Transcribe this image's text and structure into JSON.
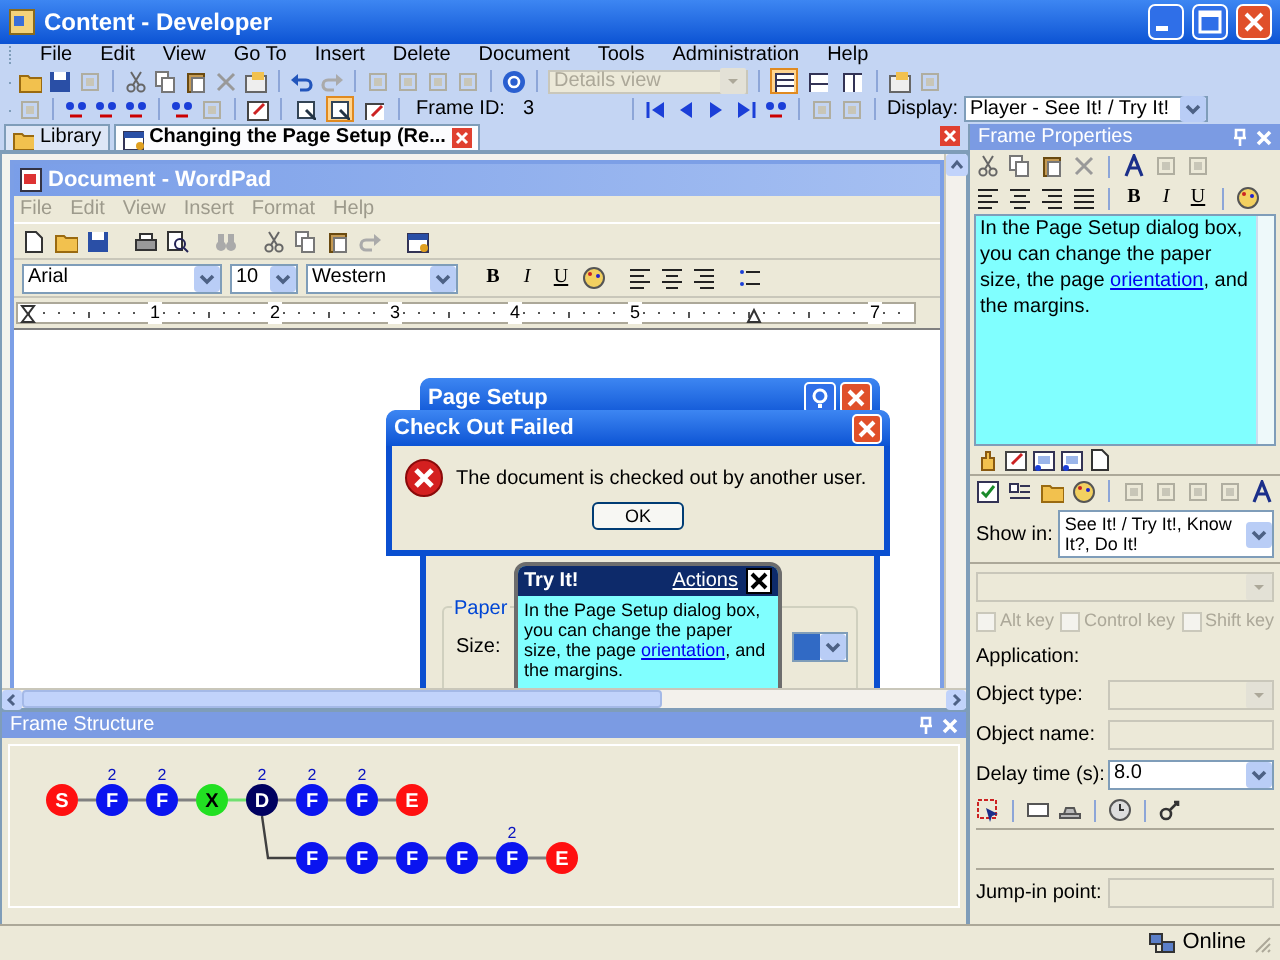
{
  "window": {
    "title": "Content - Developer"
  },
  "menu": [
    "File",
    "Edit",
    "View",
    "Go To",
    "Insert",
    "Delete",
    "Document",
    "Tools",
    "Administration",
    "Help"
  ],
  "toolbar": {
    "view_dropdown": {
      "value": "Details view",
      "disabled": true
    },
    "view_layouts": [
      {
        "selected": true
      },
      {
        "selected": false
      },
      {
        "selected": false
      }
    ],
    "frame_tools": [
      {
        "selected": false
      },
      {
        "selected": true
      },
      {
        "selected": false
      }
    ],
    "frame_id_label": "Frame ID:",
    "frame_id": "3",
    "display_label": "Display:",
    "display": "Player - See It! / Try It!"
  },
  "tabs": [
    {
      "label": "Library",
      "selected": false
    },
    {
      "label": "Changing the Page Setup (Re...",
      "selected": true
    }
  ],
  "wordpad": {
    "title": "Document - WordPad",
    "menu": [
      "File",
      "Edit",
      "View",
      "Insert",
      "Format",
      "Help"
    ],
    "font": "Arial",
    "size": "10",
    "script": "Western",
    "format_buttons": [
      "B",
      "I",
      "U"
    ],
    "ruler": [
      "1",
      "2",
      "3",
      "4",
      "5",
      "7"
    ]
  },
  "page_setup": {
    "title": "Page Setup",
    "group": "Paper",
    "size_label": "Size:"
  },
  "error_dialog": {
    "title": "Check Out Failed",
    "message": "The document is checked out by another user.",
    "button": "OK"
  },
  "bubble": {
    "title": "Try It!",
    "link": "Actions",
    "text": {
      "before": "In the Page Setup dialog box, you can change the paper size, the page ",
      "link": "orientation",
      "after": ", and the margins."
    }
  },
  "frame_properties": {
    "title": "Frame Properties",
    "format_buttons": [
      "B",
      "I",
      "U"
    ],
    "text": {
      "before": "In the Page Setup dialog box, you can change the paper size, the page ",
      "link": "orientation",
      "after": ", and the margins."
    },
    "show_in_label": "Show in:",
    "show_in": "See It! / Try It!, Know It?, Do It!",
    "checkboxes": [
      {
        "label": "Alt key",
        "checked": false,
        "disabled": true
      },
      {
        "label": "Control key",
        "checked": false,
        "disabled": true
      },
      {
        "label": "Shift key",
        "checked": false,
        "disabled": true
      }
    ],
    "application_label": "Application:",
    "object_type_label": "Object type:",
    "object_name_label": "Object name:",
    "delay_label": "Delay time (s):",
    "delay": "8.0",
    "jump_in_label": "Jump-in point:"
  },
  "frame_structure": {
    "title": "Frame Structure",
    "nodes": [
      {
        "kind": "start",
        "letter": "S"
      },
      {
        "kind": "frame",
        "letter": "F",
        "badge": "2"
      },
      {
        "kind": "frame",
        "letter": "F",
        "badge": "2"
      },
      {
        "kind": "action",
        "letter": "X"
      },
      {
        "kind": "decision",
        "letter": "D",
        "badge": "2",
        "branch": [
          {
            "kind": "frame",
            "letter": "F"
          },
          {
            "kind": "frame",
            "letter": "F"
          },
          {
            "kind": "frame",
            "letter": "F"
          },
          {
            "kind": "frame",
            "letter": "F"
          },
          {
            "kind": "frame",
            "letter": "F",
            "badge": "2"
          },
          {
            "kind": "end",
            "letter": "E"
          }
        ]
      },
      {
        "kind": "frame",
        "letter": "F",
        "badge": "2"
      },
      {
        "kind": "frame",
        "letter": "F",
        "badge": "2"
      },
      {
        "kind": "end",
        "letter": "E"
      }
    ]
  },
  "status": "Online"
}
